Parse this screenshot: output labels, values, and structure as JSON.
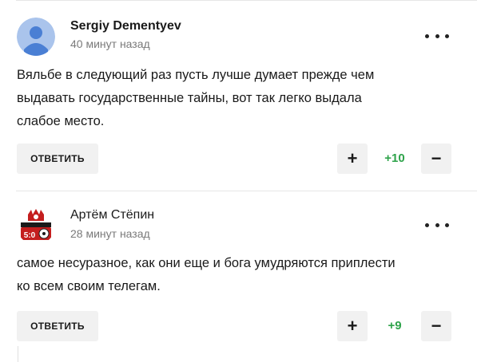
{
  "comments": [
    {
      "author": "Sergiy Dementyev",
      "time": "40 минут назад",
      "text_lines": [
        "Вяльбе в следующий раз пусть лучше думает прежде чем",
        "выдавать государственные тайны, вот так легко выдала",
        "слабое место."
      ],
      "reply_label": "ОТВЕТИТЬ",
      "upvote_label": "+",
      "score": "+10",
      "downvote_label": "−",
      "avatar_icon": "default-user-icon"
    },
    {
      "author": "Артём Стёпин",
      "time": "28 минут назад",
      "text_lines": [
        "самое несуразное, как они еще и бога умудряются приплести",
        "ко всем своим телегам."
      ],
      "reply_label": "ОТВЕТИТЬ",
      "upvote_label": "+",
      "score": "+9",
      "downvote_label": "−",
      "avatar_icon": "football-score-avatar-icon",
      "avatar_score": "5:0"
    }
  ],
  "colors": {
    "score_green": "#2ea34a",
    "button_bg": "#f1f1f1",
    "avatar_blue": "#4a7fd4"
  }
}
